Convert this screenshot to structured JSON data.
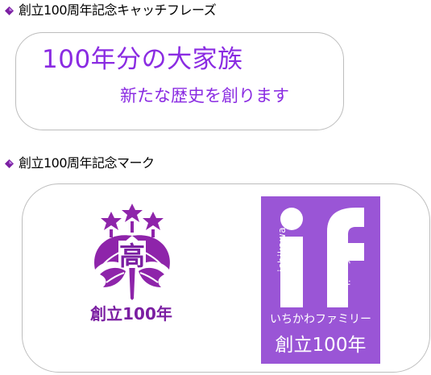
{
  "sections": {
    "catchphrase": {
      "heading": "創立100周年記念キャッチフレーズ",
      "main": "100年分の大家族",
      "sub": "新たな歴史を創ります"
    },
    "mark": {
      "heading": "創立100周年記念マーク",
      "crest_glyph": "高",
      "crest_caption": "創立100年",
      "logo_letters": "if",
      "logo_left_text": "ichikawa",
      "logo_right_text": "family",
      "logo_kana": "いちかわファミリー",
      "logo_caption": "創立100年"
    }
  },
  "colors": {
    "accent": "#8a2be2",
    "crest": "#8e24aa",
    "logo_bg": "#9a55d6",
    "bullet": "#7b1fa2"
  },
  "icons": {
    "bullet": "diamond-bullet-icon",
    "crest": "school-crest-icon",
    "logo": "ichikawa-family-logo-icon"
  }
}
